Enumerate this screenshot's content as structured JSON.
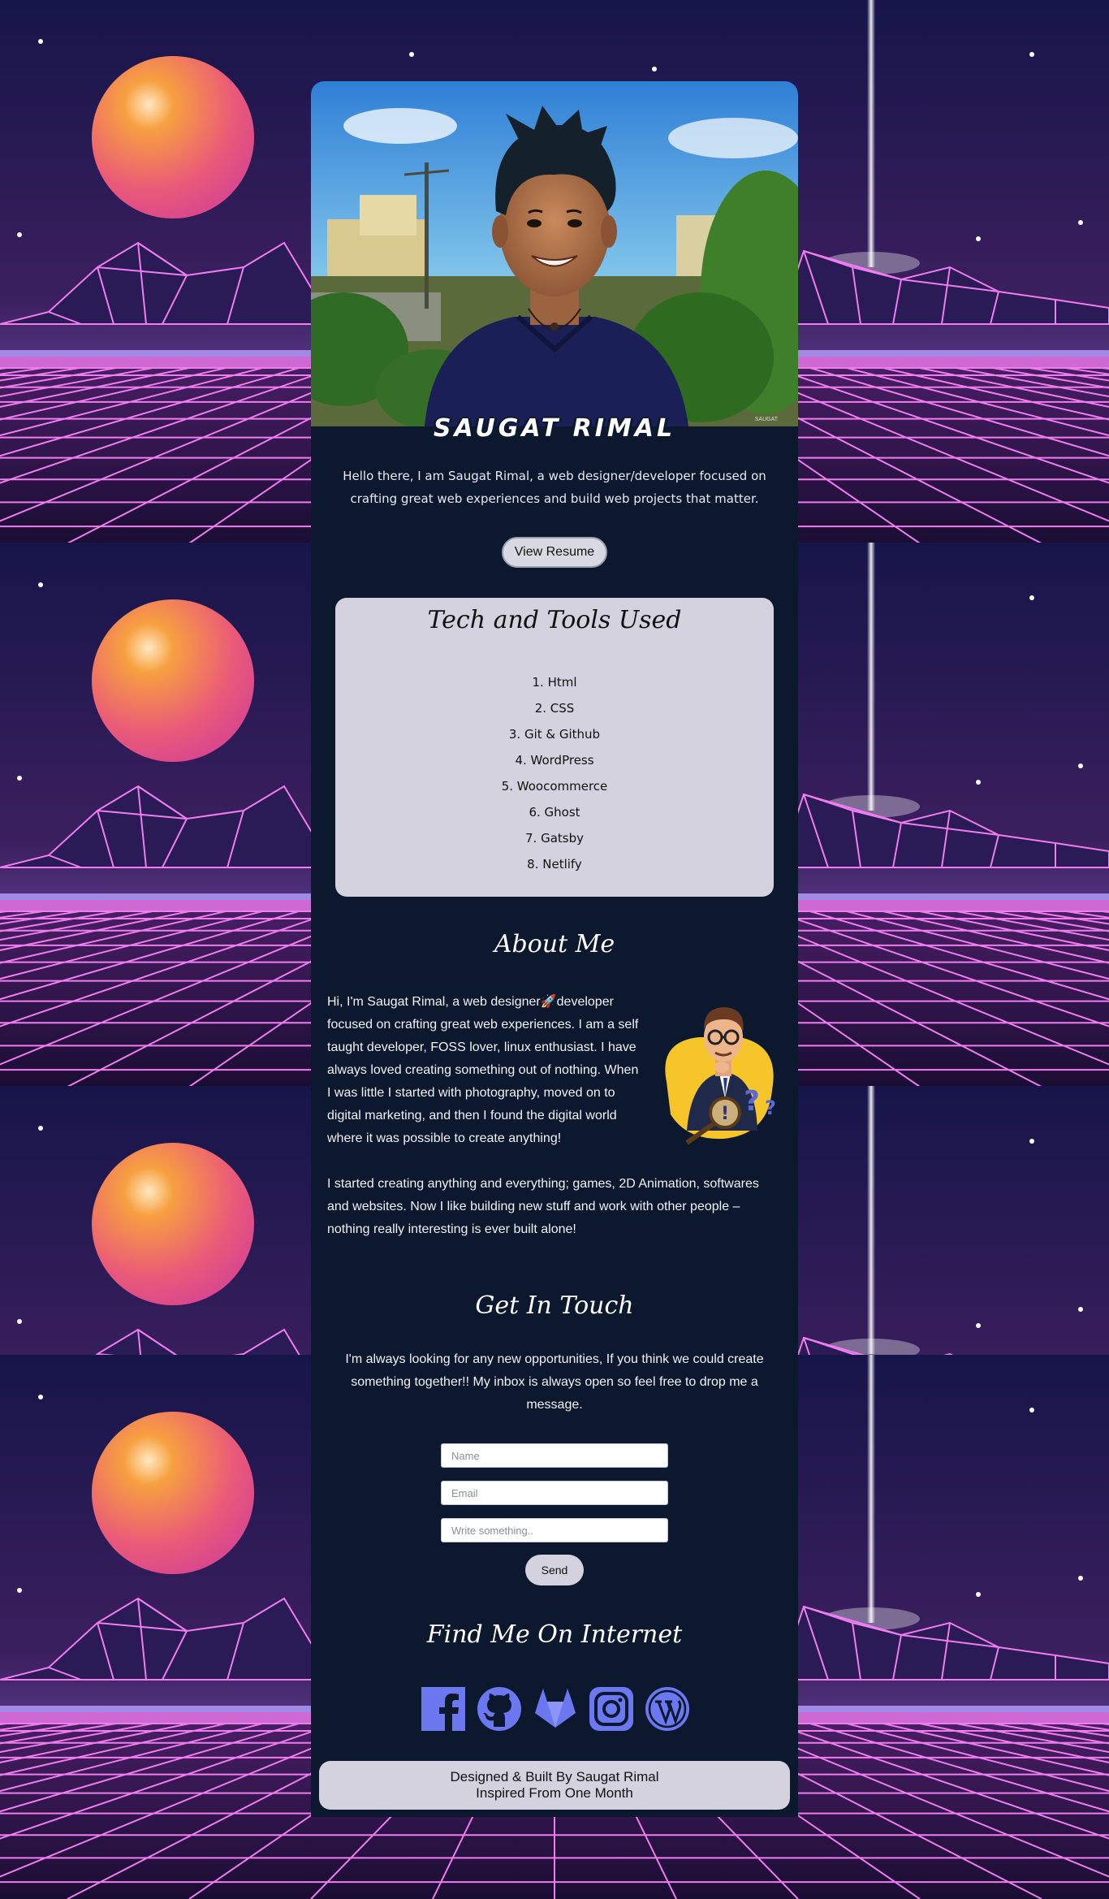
{
  "profile": {
    "name_banner": "SAUGAT RIMAL",
    "intro": "Hello there, I am Saugat Rimal, a web designer/developer focused on crafting great web experiences and build web projects that matter.",
    "resume_button": "View Resume"
  },
  "tools": {
    "title": "Tech and Tools Used",
    "items": [
      "1. Html",
      "2. CSS",
      "3. Git & Github",
      "4. WordPress",
      "5. Woocommerce",
      "6. Ghost",
      "7. Gatsby",
      "8. Netlify"
    ]
  },
  "about": {
    "title": "About Me",
    "paragraph1": "Hi, I'm Saugat Rimal, a web designer🚀developer focused on crafting great web experiences. I am a self taught developer, FOSS lover, linux enthusiast. I have always loved creating something out of nothing. When I was little I started with photography, moved on to digital marketing, and then I found the digital world where it was possible to create anything!",
    "paragraph2": "I started creating anything and everything; games, 2D Animation, softwares and websites. Now I like building new stuff and work with other people – nothing really interesting is ever built alone!"
  },
  "contact": {
    "title": "Get In Touch",
    "text": "I'm always looking for any new opportunities, If you think we could create something together!! My inbox is always open so feel free to drop me a message.",
    "name_placeholder": "Name",
    "email_placeholder": "Email",
    "message_placeholder": "Write something..",
    "send_button": "Send"
  },
  "social": {
    "title": "Find Me On Internet",
    "icons": [
      "facebook-icon",
      "github-icon",
      "gitlab-icon",
      "instagram-icon",
      "wordpress-icon"
    ],
    "icon_color": "#6b78f0"
  },
  "footer": {
    "line1": "Designed & Built By Saugat Rimal",
    "line2": "Inspired From One Month"
  },
  "colors": {
    "card_bg": "#0c182e",
    "panel_bg": "#d3d2de",
    "grid_pink": "#f07cf0"
  }
}
